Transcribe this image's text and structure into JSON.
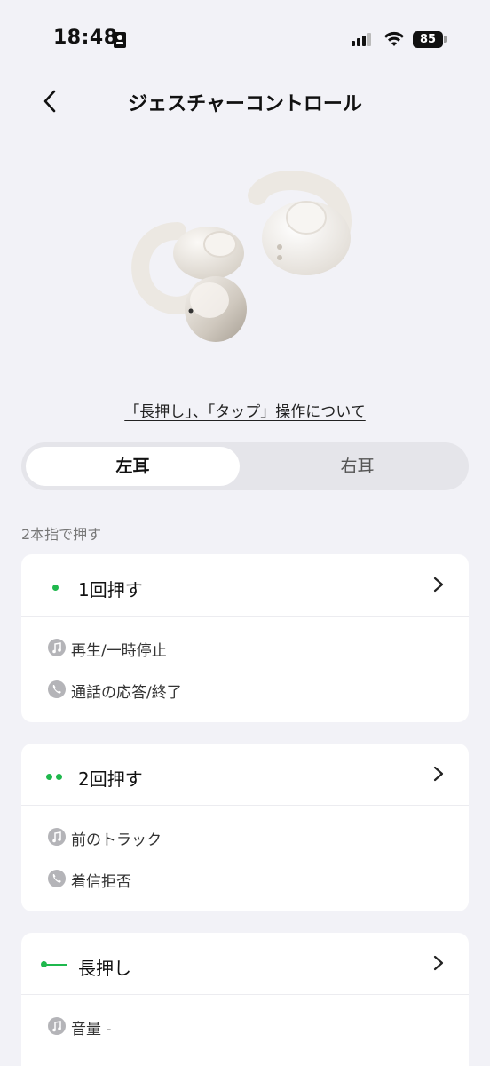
{
  "status_bar": {
    "time": "18:48",
    "battery": "85"
  },
  "header": {
    "title": "ジェスチャーコントロール"
  },
  "help_link": "「長押し」、「タップ」操作について",
  "tabs": {
    "left": "左耳",
    "right": "右耳",
    "selected": "左耳"
  },
  "section_label": "2本指で押す",
  "cards": [
    {
      "title": "1回押す",
      "marker": "single-dot",
      "actions": [
        {
          "icon": "music-note-icon",
          "label": "再生/一時停止"
        },
        {
          "icon": "phone-icon",
          "label": "通話の応答/終了"
        }
      ]
    },
    {
      "title": "2回押す",
      "marker": "double-dot",
      "actions": [
        {
          "icon": "music-note-icon",
          "label": "前のトラック"
        },
        {
          "icon": "phone-icon",
          "label": "着信拒否"
        }
      ]
    },
    {
      "title": "長押し",
      "marker": "long-press-line",
      "actions": [
        {
          "icon": "music-note-icon",
          "label": "音量 -"
        }
      ]
    }
  ],
  "colors": {
    "accent": "#1fb84d",
    "background": "#f2f2f7"
  }
}
